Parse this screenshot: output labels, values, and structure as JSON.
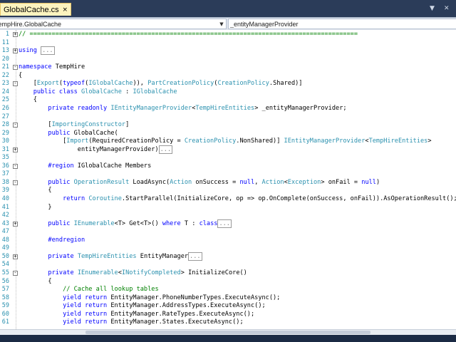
{
  "tab": {
    "label": "GlobalCache.cs",
    "close": "×"
  },
  "navbar": {
    "type_dropdown": "TempHire.GlobalCache",
    "member_dropdown": "_entityManagerProvider"
  },
  "code_lines": [
    {
      "num": "1",
      "html": "<span class=\"sepline\">// =========================================================================================</span>",
      "fold": "+"
    },
    {
      "num": "11",
      "html": ""
    },
    {
      "num": "13",
      "html": "<span class=\"kw\">using</span> <span class=\"box\">...</span>",
      "fold": "+"
    },
    {
      "num": "20",
      "html": ""
    },
    {
      "num": "21",
      "html": "<span class=\"kw\">namespace</span> TempHire",
      "fold": "-"
    },
    {
      "num": "22",
      "html": "{"
    },
    {
      "num": "23",
      "html": "    [<span class=\"ty\">Export</span>(<span class=\"kw\">typeof</span>(<span class=\"ty\">IGlobalCache</span>)), <span class=\"ty\">PartCreationPolicy</span>(<span class=\"ty\">CreationPolicy</span>.Shared)]",
      "fold": "-"
    },
    {
      "num": "24",
      "html": "    <span class=\"kw\">public class</span> <span class=\"ty\">GlobalCache</span> : <span class=\"ty\">IGlobalCache</span>"
    },
    {
      "num": "25",
      "html": "    {"
    },
    {
      "num": "26",
      "html": "        <span class=\"kw\">private readonly</span> <span class=\"ty\">IEntityManagerProvider</span>&lt;<span class=\"ty\">TempHireEntities</span>&gt; _entityManagerProvider;"
    },
    {
      "num": "27",
      "html": ""
    },
    {
      "num": "28",
      "html": "        [<span class=\"ty\">ImportingConstructor</span>]",
      "fold": "-"
    },
    {
      "num": "29",
      "html": "        <span class=\"kw\">public</span> GlobalCache("
    },
    {
      "num": "30",
      "html": "            [<span class=\"ty\">Import</span>(RequiredCreationPolicy = <span class=\"ty\">CreationPolicy</span>.NonShared)] <span class=\"ty\">IEntityManagerProvider</span>&lt;<span class=\"ty\">TempHireEntities</span>&gt;"
    },
    {
      "num": "31",
      "html": "                entityManagerProvider)<span class=\"box\">...</span>",
      "fold": "+"
    },
    {
      "num": "35",
      "html": ""
    },
    {
      "num": "36",
      "html": "        <span class=\"kw\">#region</span> IGlobalCache Members",
      "fold": "-"
    },
    {
      "num": "37",
      "html": ""
    },
    {
      "num": "38",
      "html": "        <span class=\"kw\">public</span> <span class=\"ty\">OperationResult</span> LoadAsync(<span class=\"ty\">Action</span> onSuccess = <span class=\"kw\">null</span>, <span class=\"ty\">Action</span>&lt;<span class=\"ty\">Exception</span>&gt; onFail = <span class=\"kw\">null</span>)",
      "fold": "-"
    },
    {
      "num": "39",
      "html": "        {"
    },
    {
      "num": "40",
      "html": "            <span class=\"kw\">return</span> <span class=\"ty\">Coroutine</span>.StartParallel(InitializeCore, op =&gt; op.OnComplete(onSuccess, onFail)).AsOperationResult();"
    },
    {
      "num": "41",
      "html": "        }"
    },
    {
      "num": "42",
      "html": ""
    },
    {
      "num": "43",
      "html": "        <span class=\"kw\">public</span> <span class=\"ty\">IEnumerable</span>&lt;T&gt; Get&lt;T&gt;() <span class=\"kw\">where</span> T : <span class=\"kw\">class</span><span class=\"box\">...</span>",
      "fold": "+"
    },
    {
      "num": "47",
      "html": ""
    },
    {
      "num": "48",
      "html": "        <span class=\"kw\">#endregion</span>"
    },
    {
      "num": "49",
      "html": ""
    },
    {
      "num": "50",
      "html": "        <span class=\"kw\">private</span> <span class=\"ty\">TempHireEntities</span> EntityManager<span class=\"box\">...</span>",
      "fold": "+"
    },
    {
      "num": "54",
      "html": ""
    },
    {
      "num": "55",
      "html": "        <span class=\"kw\">private</span> <span class=\"ty\">IEnumerable</span>&lt;<span class=\"ty\">INotifyCompleted</span>&gt; InitializeCore()",
      "fold": "-"
    },
    {
      "num": "56",
      "html": "        {"
    },
    {
      "num": "57",
      "html": "            <span class=\"cm\">// Cache all lookup tables</span>"
    },
    {
      "num": "58",
      "html": "            <span class=\"kw\">yield return</span> EntityManager.PhoneNumberTypes.ExecuteAsync();"
    },
    {
      "num": "59",
      "html": "            <span class=\"kw\">yield return</span> EntityManager.AddressTypes.ExecuteAsync();"
    },
    {
      "num": "60",
      "html": "            <span class=\"kw\">yield return</span> EntityManager.RateTypes.ExecuteAsync();"
    },
    {
      "num": "61",
      "html": "            <span class=\"kw\">yield return</span> EntityManager.States.ExecuteAsync();"
    }
  ]
}
